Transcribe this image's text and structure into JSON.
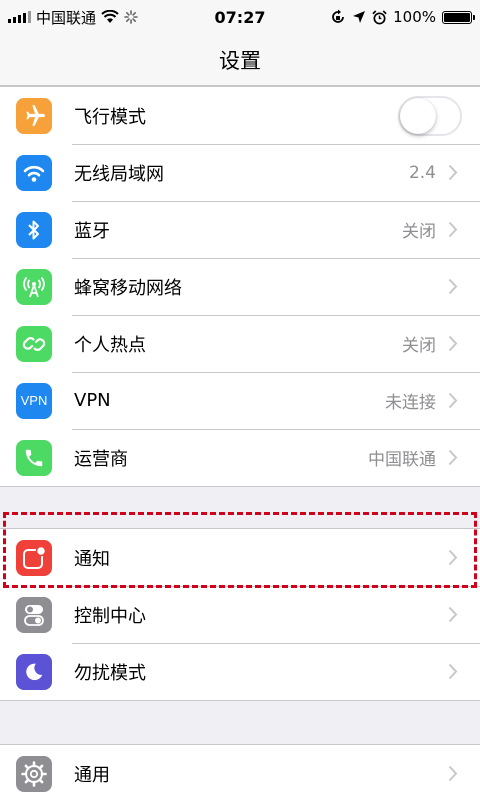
{
  "status_bar": {
    "carrier": "中国联通",
    "time": "07:27",
    "battery_text": "100%"
  },
  "nav": {
    "title": "设置"
  },
  "groups": [
    {
      "items": [
        {
          "label": "飞行模式",
          "icon": "airplane-icon",
          "color": "#f7a13a",
          "control": "toggle",
          "toggle_on": false
        },
        {
          "label": "无线局域网",
          "icon": "wifi-icon",
          "color": "#1e88f0",
          "value": "2.4"
        },
        {
          "label": "蓝牙",
          "icon": "bluetooth-icon",
          "color": "#1e88f0",
          "value": "关闭"
        },
        {
          "label": "蜂窝移动网络",
          "icon": "cellular-antenna-icon",
          "color": "#4cd964",
          "value": ""
        },
        {
          "label": "个人热点",
          "icon": "hotspot-link-icon",
          "color": "#4cd964",
          "value": "关闭"
        },
        {
          "label": "VPN",
          "icon": "vpn-icon",
          "icon_text": "VPN",
          "color": "#1e88f0",
          "value": "未连接"
        },
        {
          "label": "运营商",
          "icon": "phone-icon",
          "color": "#4cd964",
          "value": "中国联通"
        }
      ]
    },
    {
      "items": [
        {
          "label": "通知",
          "icon": "notifications-icon",
          "color": "#f0403a",
          "value": "",
          "highlighted": true
        },
        {
          "label": "控制中心",
          "icon": "control-center-icon",
          "color": "#8e8e93",
          "value": ""
        },
        {
          "label": "勿扰模式",
          "icon": "moon-icon",
          "color": "#5b52d6",
          "value": ""
        }
      ]
    },
    {
      "items": [
        {
          "label": "通用",
          "icon": "gear-icon",
          "color": "#8e8e93",
          "value": ""
        }
      ]
    }
  ]
}
